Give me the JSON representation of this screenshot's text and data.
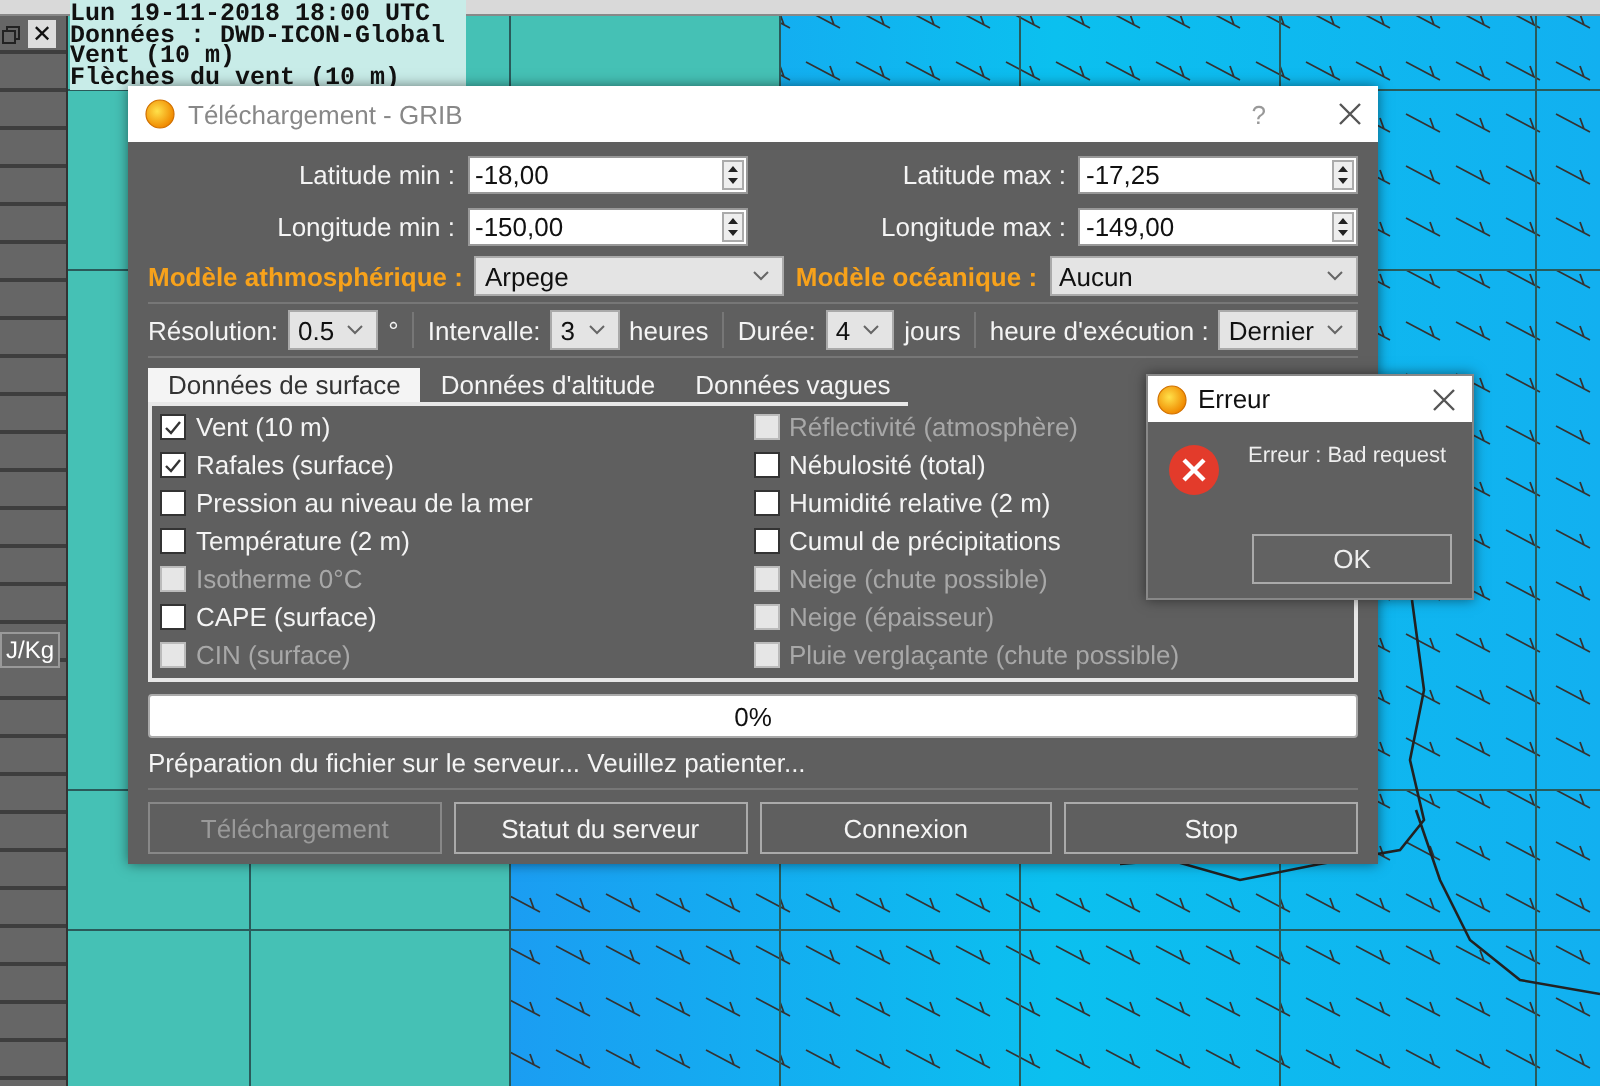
{
  "map_overlay": {
    "lines": [
      "Lun 19-11-2018 18:00 UTC",
      "Données : DWD-ICON-Global",
      "Vent (10 m)",
      "Flèches du vent (10 m)"
    ]
  },
  "side_panel": {
    "close": "✕",
    "unit_label": "J/Kg"
  },
  "dialog": {
    "title": "Téléchargement - GRIB",
    "help": "?",
    "fields": [
      {
        "label": "Latitude min :",
        "value": "-18,00"
      },
      {
        "label": "Latitude max :",
        "value": "-17,25"
      },
      {
        "label": "Longitude min :",
        "value": "-150,00"
      },
      {
        "label": "Longitude max :",
        "value": "-149,00"
      }
    ],
    "models": [
      {
        "label": "Modèle athmosphérique :",
        "value": "Arpege"
      },
      {
        "label": "Modèle océanique :",
        "value": "Aucun"
      }
    ],
    "options": [
      {
        "label": "Résolution:",
        "value": "0.5",
        "unit": "°"
      },
      {
        "label": "Intervalle:",
        "value": "3",
        "unit": "heures"
      },
      {
        "label": "Durée:",
        "value": "4",
        "unit": "jours"
      },
      {
        "label": "heure d'exécution :",
        "value": "Dernier"
      }
    ],
    "tabs": [
      {
        "label": "Données de surface",
        "selected": true
      },
      {
        "label": "Données d'altitude",
        "selected": false
      },
      {
        "label": "Données vagues",
        "selected": false
      }
    ],
    "checkboxes": [
      {
        "label": "Vent (10 m)",
        "checked": true,
        "disabled": false
      },
      {
        "label": "Rafales (surface)",
        "checked": true,
        "disabled": false
      },
      {
        "label": "Pression au niveau de la mer",
        "checked": false,
        "disabled": false
      },
      {
        "label": "Température (2 m)",
        "checked": false,
        "disabled": false
      },
      {
        "label": "Isotherme 0°C",
        "checked": false,
        "disabled": true
      },
      {
        "label": "CAPE (surface)",
        "checked": false,
        "disabled": false
      },
      {
        "label": "CIN (surface)",
        "checked": false,
        "disabled": true
      },
      {
        "label": "Réflectivité (atmosphère)",
        "checked": false,
        "disabled": true
      },
      {
        "label": "Nébulosité (total)",
        "checked": false,
        "disabled": false
      },
      {
        "label": "Humidité relative (2 m)",
        "checked": false,
        "disabled": false
      },
      {
        "label": "Cumul de précipitations",
        "checked": false,
        "disabled": false
      },
      {
        "label": "Neige (chute possible)",
        "checked": false,
        "disabled": true
      },
      {
        "label": "Neige (épaisseur)",
        "checked": false,
        "disabled": true
      },
      {
        "label": "Pluie verglaçante (chute possible)",
        "checked": false,
        "disabled": true
      }
    ],
    "progress": {
      "level": 0,
      "text": "0%"
    },
    "status": "Préparation du fichier sur le serveur... Veuillez patienter...",
    "buttons": [
      {
        "label": "Téléchargement",
        "disabled": true
      },
      {
        "label": "Statut du serveur",
        "disabled": false
      },
      {
        "label": "Connexion",
        "disabled": false
      },
      {
        "label": "Stop",
        "disabled": false
      }
    ]
  },
  "error_dialog": {
    "title": "Erreur",
    "message": "Erreur : Bad request",
    "button": "OK"
  }
}
